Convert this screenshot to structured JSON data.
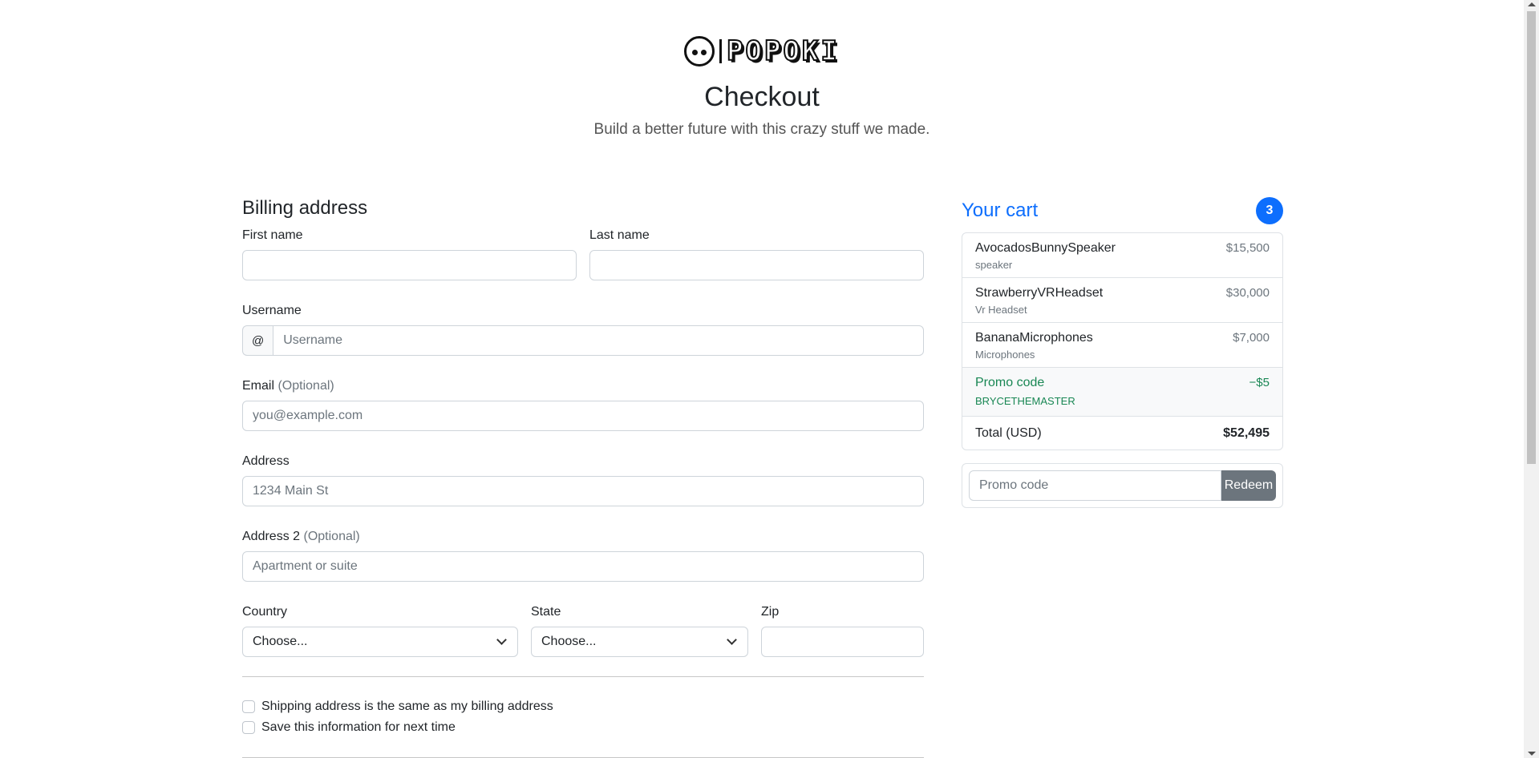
{
  "header": {
    "logo_text": "POPOKI",
    "title": "Checkout",
    "subtitle": "Build a better future with this crazy stuff we made."
  },
  "billing": {
    "heading": "Billing address",
    "first_name_label": "First name",
    "last_name_label": "Last name",
    "username_label": "Username",
    "username_prefix": "@",
    "username_placeholder": "Username",
    "email_label": "Email",
    "optional_text": "(Optional)",
    "email_placeholder": "you@example.com",
    "address_label": "Address",
    "address_placeholder": "1234 Main St",
    "address2_label": "Address 2",
    "address2_placeholder": "Apartment or suite",
    "country_label": "Country",
    "country_value": "Choose...",
    "state_label": "State",
    "state_value": "Choose...",
    "zip_label": "Zip",
    "checkbox_same_address": "Shipping address is the same as my billing address",
    "checkbox_save_info": "Save this information for next time"
  },
  "cart": {
    "title": "Your cart",
    "count": "3",
    "items": [
      {
        "name": "AvocadosBunnySpeaker",
        "desc": "speaker",
        "price": "$15,500"
      },
      {
        "name": "StrawberryVRHeadset",
        "desc": "Vr Headset",
        "price": "$30,000"
      },
      {
        "name": "BananaMicrophones",
        "desc": "Microphones",
        "price": "$7,000"
      }
    ],
    "promo": {
      "label": "Promo code",
      "code": "BRYCETHEMASTER",
      "discount": "−$5"
    },
    "total_label": "Total (USD)",
    "total_value": "$52,495",
    "promo_placeholder": "Promo code",
    "redeem_label": "Redeem"
  },
  "colors": {
    "accent": "#0d6efd",
    "success": "#198754",
    "secondary": "#6c757d"
  }
}
